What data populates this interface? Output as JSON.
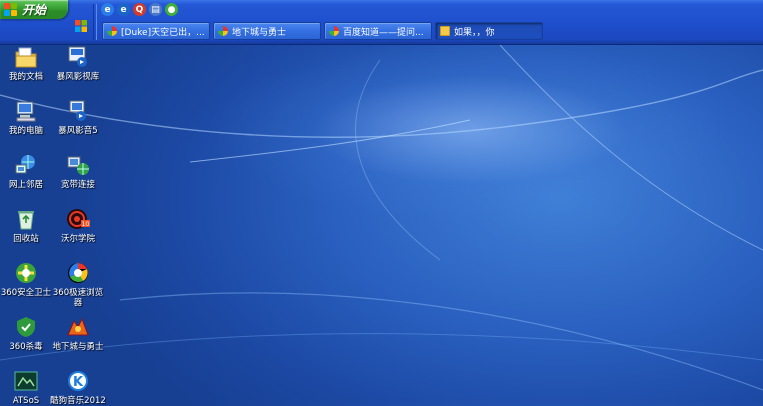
{
  "taskbar": {
    "start_label": "开始",
    "quick_launch": [
      {
        "name": "ie-quick-icon",
        "glyph": "e",
        "color": "#2b7de9"
      },
      {
        "name": "browser-quick-icon",
        "glyph": "e",
        "color": "#1a66c8"
      },
      {
        "name": "qq-quick-icon",
        "glyph": "Q",
        "color": "#d23a2a"
      },
      {
        "name": "desktop-quick-icon",
        "glyph": "▤",
        "color": "#4a78c8"
      },
      {
        "name": "chrome-quick-icon",
        "glyph": "●",
        "color": "#3fae3a"
      }
    ],
    "tasks": [
      {
        "label": "[Duke]天空已出，...",
        "icon": "t-ie",
        "active": false
      },
      {
        "label": "地下城与勇士",
        "icon": "t-ie",
        "active": false
      },
      {
        "label": "百度知道——提问...",
        "icon": "t-ie",
        "active": false
      },
      {
        "label": "如果，，你",
        "icon": "t-folder",
        "active": true
      }
    ]
  },
  "desktop": {
    "icons_left": [
      {
        "label": "我的文档",
        "icon": "documents-folder-icon"
      },
      {
        "label": "我的电脑",
        "icon": "my-computer-icon"
      },
      {
        "label": "网上邻居",
        "icon": "network-icon"
      },
      {
        "label": "回收站",
        "icon": "recycle-bin-icon"
      },
      {
        "label": "360安全卫士",
        "icon": "360-safe-icon"
      },
      {
        "label": "360杀毒",
        "icon": "360-antivirus-icon"
      },
      {
        "label": "ATSoS",
        "icon": "atsos-icon"
      }
    ],
    "icons_right": [
      {
        "label": "暴风影视库",
        "icon": "storm-video-library-icon"
      },
      {
        "label": "暴风影音5",
        "icon": "storm-player-icon"
      },
      {
        "label": "宽带连接",
        "icon": "broadband-icon"
      },
      {
        "label": "沃尔学院",
        "icon": "academy-icon"
      },
      {
        "label": "360极速浏览器",
        "icon": "360-browser-icon"
      },
      {
        "label": "地下城与勇士",
        "icon": "dnf-game-icon"
      },
      {
        "label": "酷狗音乐2012",
        "icon": "kugou-icon"
      }
    ]
  }
}
